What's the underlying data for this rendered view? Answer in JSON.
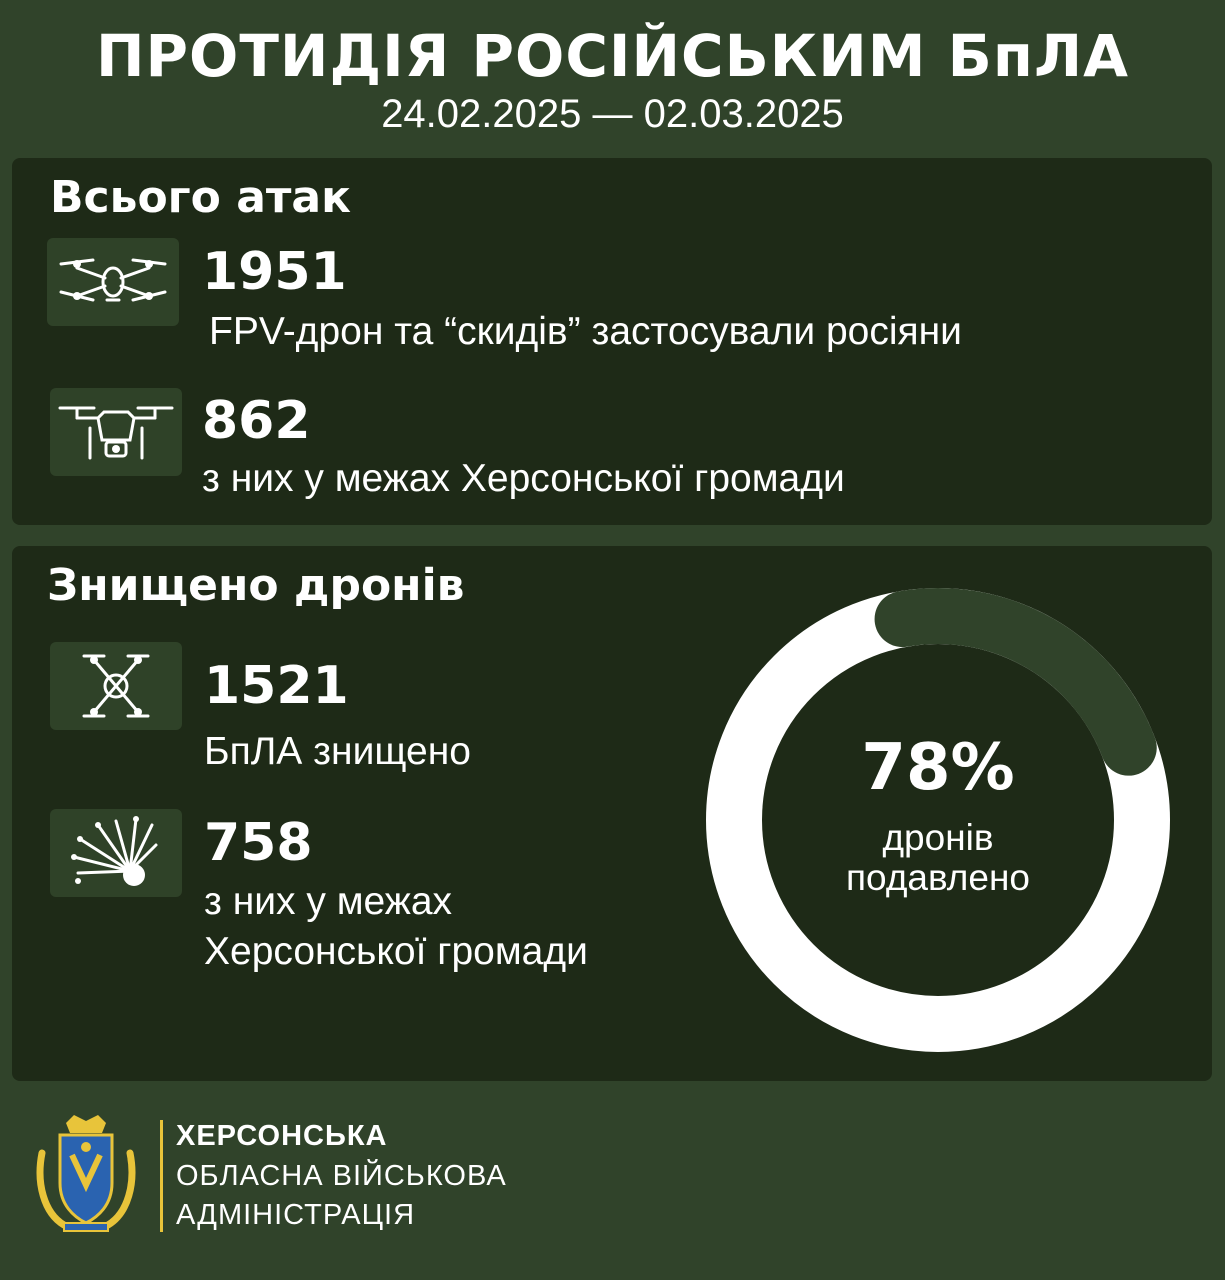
{
  "header": {
    "title": "ПРОТИДІЯ РОСІЙСЬКИМ БпЛА",
    "dates": "24.02.2025 — 02.03.2025"
  },
  "attacks": {
    "title": "Всього атак",
    "items": [
      {
        "icon": "fpv-drone-icon",
        "value": "1951",
        "caption": "FPV-дрон та “скидів” застосували росіяни"
      },
      {
        "icon": "bomber-drone-icon",
        "value": "862",
        "caption": "з них у межах Херсонської громади"
      }
    ]
  },
  "destroyed": {
    "title": "Знищено дронів",
    "items": [
      {
        "icon": "quadcopter-icon",
        "value": "1521",
        "caption": "БпЛА знищено"
      },
      {
        "icon": "explosion-icon",
        "value": "758",
        "caption_line1": "з них у межах",
        "caption_line2": "Херсонської громади"
      }
    ],
    "suppressed": {
      "percent": 78,
      "label": "78%",
      "caption_line1": "дронів",
      "caption_line2": "подавлено"
    }
  },
  "footer": {
    "line1": "ХЕРСОНСЬКА",
    "line2": "ОБЛАСНА ВІЙСЬКОВА",
    "line3": "АДМІНІСТРАЦІЯ"
  },
  "colors": {
    "background": "#30432a",
    "panel": "#1e2a17",
    "ring_filled": "#ffffff",
    "ring_empty": "#30432a",
    "accent": "#e8c43a"
  }
}
